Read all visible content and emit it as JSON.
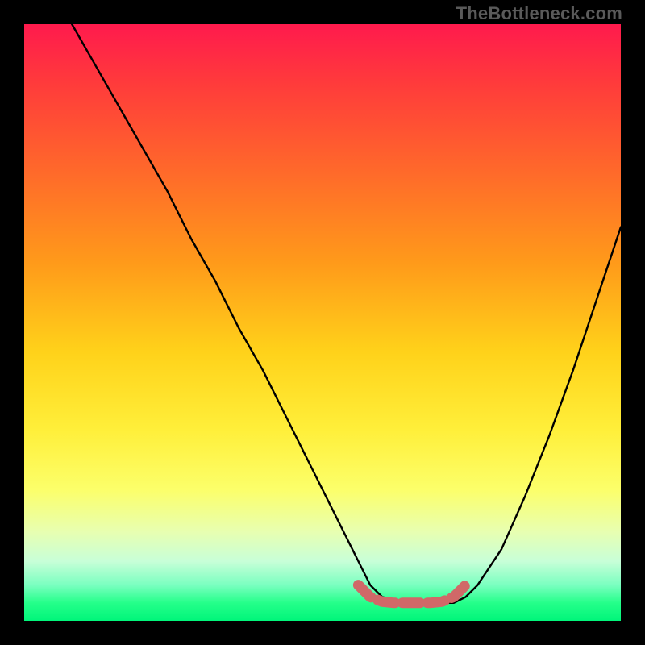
{
  "watermark": "TheBottleneck.com",
  "colors": {
    "frame_bg": "#000000",
    "watermark": "#5a5a5a",
    "curve": "#000000",
    "flat_segment": "#d06868",
    "gradient_top": "#ff1a4d",
    "gradient_bottom": "#00f57a"
  },
  "chart_data": {
    "type": "line",
    "title": "",
    "xlabel": "",
    "ylabel": "",
    "xlim": [
      0,
      100
    ],
    "ylim": [
      0,
      100
    ],
    "annotations": [
      "Rainbow gradient background — red (top) → green (bottom)"
    ],
    "series": [
      {
        "name": "bottleneck-curve",
        "x": [
          8,
          12,
          16,
          20,
          24,
          28,
          32,
          36,
          40,
          44,
          48,
          52,
          56,
          58,
          60,
          64,
          68,
          72,
          74,
          76,
          80,
          84,
          88,
          92,
          96,
          100
        ],
        "y": [
          100,
          93,
          86,
          79,
          72,
          64,
          57,
          49,
          42,
          34,
          26,
          18,
          10,
          6,
          4,
          3,
          3,
          3,
          4,
          6,
          12,
          21,
          31,
          42,
          54,
          66
        ]
      },
      {
        "name": "flat-bottom-highlight",
        "x": [
          56,
          58,
          60,
          62,
          64,
          66,
          68,
          70,
          72,
          74
        ],
        "y": [
          6,
          4,
          3.2,
          3,
          3,
          3,
          3,
          3.2,
          4,
          6
        ]
      }
    ]
  }
}
